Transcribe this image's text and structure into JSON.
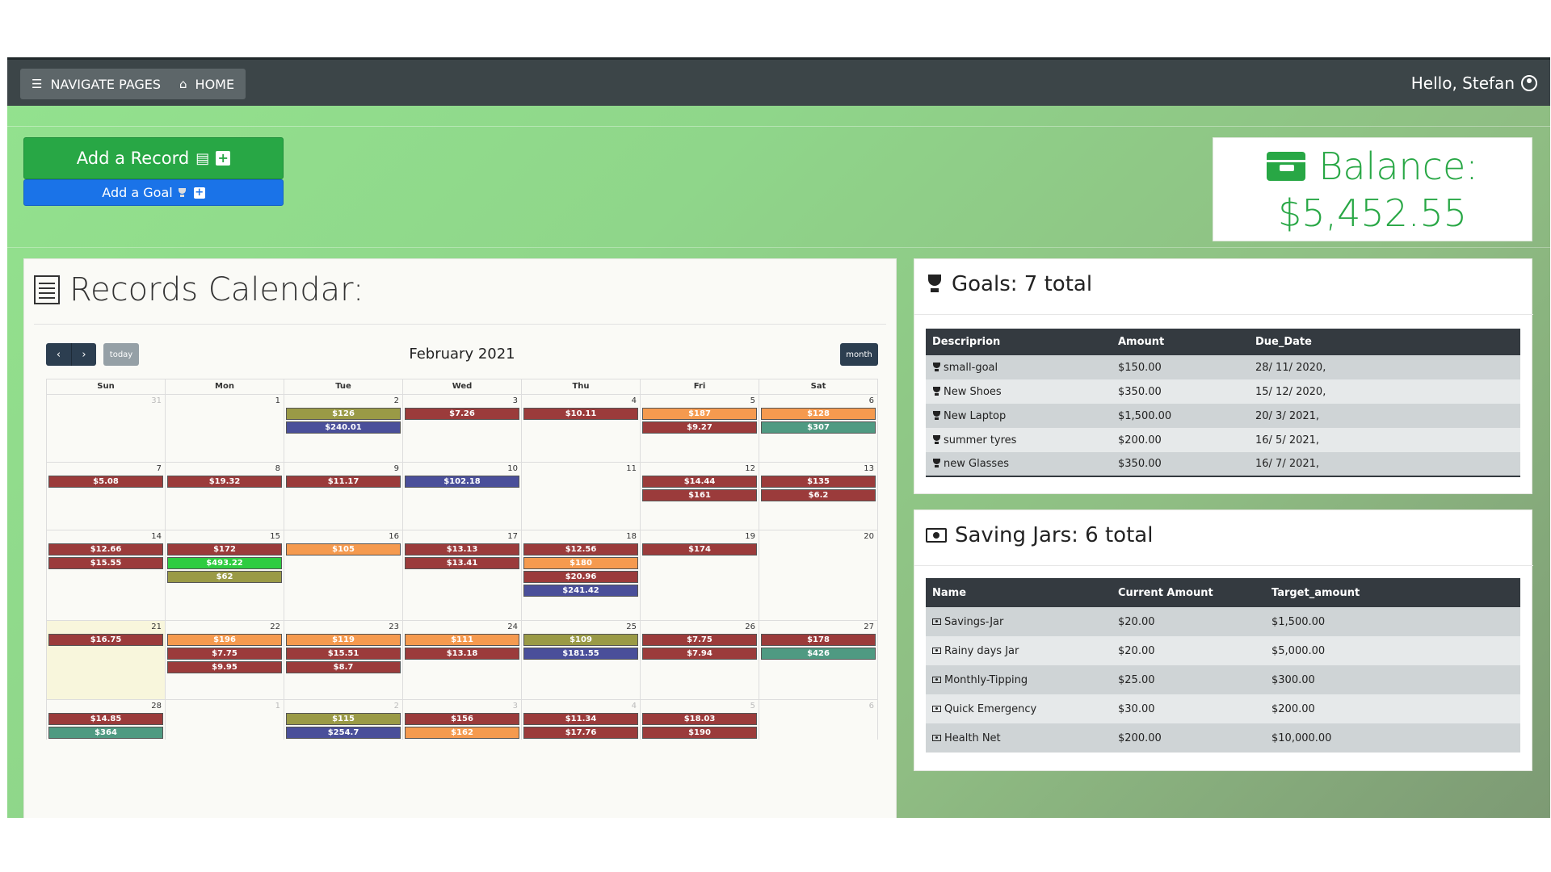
{
  "nav": {
    "navigate_label": "NAVIGATE PAGES",
    "home_label": "HOME",
    "greeting": "Hello, Stefan"
  },
  "actions": {
    "add_record_label": "Add a Record",
    "add_goal_label": "Add a Goal"
  },
  "balance": {
    "title": "Balance:",
    "value": "$5,452.55"
  },
  "calendar": {
    "heading": "Records Calendar:",
    "month_title": "February 2021",
    "today_label": "today",
    "month_label": "month",
    "days_of_week": [
      "Sun",
      "Mon",
      "Tue",
      "Wed",
      "Thu",
      "Fri",
      "Sat"
    ],
    "colors": {
      "red": "#9b3b3b",
      "orange": "#f59a4f",
      "olive": "#9a9a46",
      "blue": "#4a4f9a",
      "teal": "#4f9a82",
      "green": "#2ecc40"
    },
    "weeks": [
      {
        "days": [
          {
            "num": "31",
            "other": true,
            "events": []
          },
          {
            "num": "1",
            "events": []
          },
          {
            "num": "2",
            "events": [
              {
                "amount": "$126",
                "color": "olive"
              },
              {
                "amount": "$240.01",
                "color": "blue"
              }
            ]
          },
          {
            "num": "3",
            "events": [
              {
                "amount": "$7.26",
                "color": "red"
              }
            ]
          },
          {
            "num": "4",
            "events": [
              {
                "amount": "$10.11",
                "color": "red"
              }
            ]
          },
          {
            "num": "5",
            "events": [
              {
                "amount": "$187",
                "color": "orange"
              },
              {
                "amount": "$9.27",
                "color": "red"
              }
            ]
          },
          {
            "num": "6",
            "events": [
              {
                "amount": "$128",
                "color": "orange"
              },
              {
                "amount": "$307",
                "color": "teal"
              }
            ]
          }
        ]
      },
      {
        "days": [
          {
            "num": "7",
            "events": [
              {
                "amount": "$5.08",
                "color": "red"
              }
            ]
          },
          {
            "num": "8",
            "events": [
              {
                "amount": "$19.32",
                "color": "red"
              }
            ]
          },
          {
            "num": "9",
            "events": [
              {
                "amount": "$11.17",
                "color": "red"
              }
            ]
          },
          {
            "num": "10",
            "events": [
              {
                "amount": "$102.18",
                "color": "blue"
              }
            ]
          },
          {
            "num": "11",
            "events": []
          },
          {
            "num": "12",
            "events": [
              {
                "amount": "$14.44",
                "color": "red"
              },
              {
                "amount": "$161",
                "color": "red"
              }
            ]
          },
          {
            "num": "13",
            "events": [
              {
                "amount": "$135",
                "color": "red"
              },
              {
                "amount": "$6.2",
                "color": "red"
              }
            ]
          }
        ]
      },
      {
        "days": [
          {
            "num": "14",
            "events": [
              {
                "amount": "$12.66",
                "color": "red"
              },
              {
                "amount": "$15.55",
                "color": "red"
              }
            ]
          },
          {
            "num": "15",
            "events": [
              {
                "amount": "$172",
                "color": "red"
              },
              {
                "amount": "$493.22",
                "color": "green"
              },
              {
                "amount": "$62",
                "color": "olive"
              }
            ]
          },
          {
            "num": "16",
            "events": [
              {
                "amount": "$105",
                "color": "orange"
              }
            ]
          },
          {
            "num": "17",
            "events": [
              {
                "amount": "$13.13",
                "color": "red"
              },
              {
                "amount": "$13.41",
                "color": "red"
              }
            ]
          },
          {
            "num": "18",
            "events": [
              {
                "amount": "$12.56",
                "color": "red"
              },
              {
                "amount": "$180",
                "color": "orange"
              },
              {
                "amount": "$20.96",
                "color": "red"
              },
              {
                "amount": "$241.42",
                "color": "blue"
              }
            ]
          },
          {
            "num": "19",
            "events": [
              {
                "amount": "$174",
                "color": "red"
              }
            ]
          },
          {
            "num": "20",
            "events": []
          }
        ]
      },
      {
        "days": [
          {
            "num": "21",
            "today": true,
            "events": [
              {
                "amount": "$16.75",
                "color": "red"
              }
            ]
          },
          {
            "num": "22",
            "events": [
              {
                "amount": "$196",
                "color": "orange"
              },
              {
                "amount": "$7.75",
                "color": "red"
              },
              {
                "amount": "$9.95",
                "color": "red"
              }
            ]
          },
          {
            "num": "23",
            "events": [
              {
                "amount": "$119",
                "color": "orange"
              },
              {
                "amount": "$15.51",
                "color": "red"
              },
              {
                "amount": "$8.7",
                "color": "red"
              }
            ]
          },
          {
            "num": "24",
            "events": [
              {
                "amount": "$111",
                "color": "orange"
              },
              {
                "amount": "$13.18",
                "color": "red"
              }
            ]
          },
          {
            "num": "25",
            "events": [
              {
                "amount": "$109",
                "color": "olive"
              },
              {
                "amount": "$181.55",
                "color": "blue"
              }
            ]
          },
          {
            "num": "26",
            "events": [
              {
                "amount": "$7.75",
                "color": "red"
              },
              {
                "amount": "$7.94",
                "color": "red"
              }
            ]
          },
          {
            "num": "27",
            "events": [
              {
                "amount": "$178",
                "color": "red"
              },
              {
                "amount": "$426",
                "color": "teal"
              }
            ]
          }
        ]
      },
      {
        "days": [
          {
            "num": "28",
            "events": [
              {
                "amount": "$14.85",
                "color": "red"
              },
              {
                "amount": "$364",
                "color": "teal"
              }
            ]
          },
          {
            "num": "1",
            "other": true,
            "events": []
          },
          {
            "num": "2",
            "other": true,
            "events": [
              {
                "amount": "$115",
                "color": "olive"
              },
              {
                "amount": "$254.7",
                "color": "blue"
              }
            ]
          },
          {
            "num": "3",
            "other": true,
            "events": [
              {
                "amount": "$156",
                "color": "red"
              },
              {
                "amount": "$162",
                "color": "orange"
              }
            ]
          },
          {
            "num": "4",
            "other": true,
            "events": [
              {
                "amount": "$11.34",
                "color": "red"
              },
              {
                "amount": "$17.76",
                "color": "red"
              }
            ]
          },
          {
            "num": "5",
            "other": true,
            "events": [
              {
                "amount": "$18.03",
                "color": "red"
              },
              {
                "amount": "$190",
                "color": "red"
              }
            ]
          },
          {
            "num": "6",
            "other": true,
            "events": []
          }
        ]
      }
    ]
  },
  "goals": {
    "title": "Goals: 7 total",
    "columns": [
      "Descriprion",
      "Amount",
      "Due_Date"
    ],
    "rows": [
      [
        "small-goal",
        "$150.00",
        "28/ 11/ 2020,"
      ],
      [
        "New Shoes",
        "$350.00",
        "15/ 12/ 2020,"
      ],
      [
        "New Laptop",
        "$1,500.00",
        "20/ 3/ 2021,"
      ],
      [
        "summer tyres",
        "$200.00",
        "16/ 5/ 2021,"
      ],
      [
        "new Glasses",
        "$350.00",
        "16/ 7/ 2021,"
      ]
    ]
  },
  "jars": {
    "title": "Saving Jars: 6 total",
    "columns": [
      "Name",
      "Current Amount",
      "Target_amount"
    ],
    "rows": [
      [
        "Savings-Jar",
        "$20.00",
        "$1,500.00"
      ],
      [
        "Rainy days Jar",
        "$20.00",
        "$5,000.00"
      ],
      [
        "Monthly-Tipping",
        "$25.00",
        "$300.00"
      ],
      [
        "Quick Emergency",
        "$30.00",
        "$200.00"
      ],
      [
        "Health Net",
        "$200.00",
        "$10,000.00"
      ]
    ]
  }
}
